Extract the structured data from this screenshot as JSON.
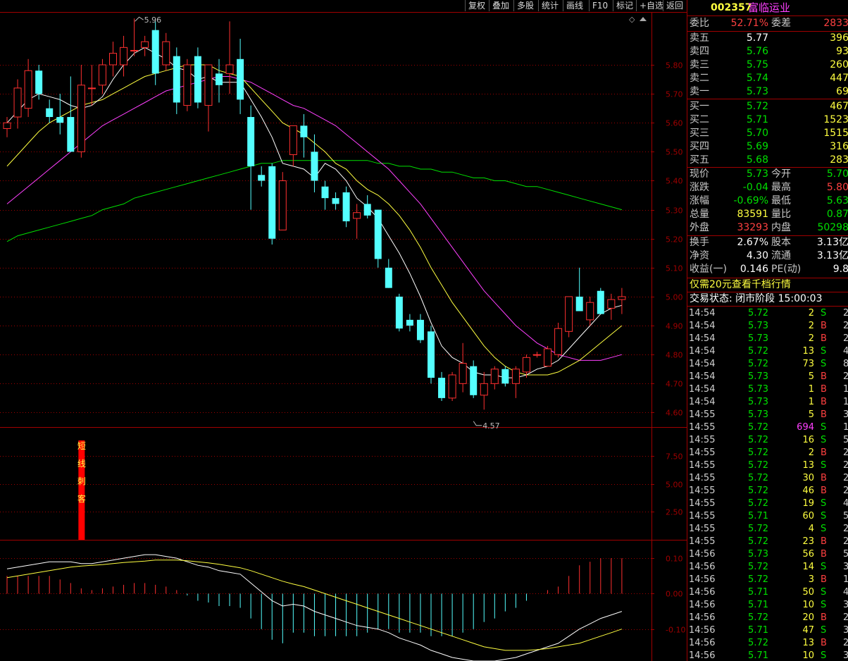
{
  "toolbar": [
    "复权",
    "叠加",
    "多股",
    "统计",
    "画线",
    "F10",
    "标记",
    "+自选",
    "返回"
  ],
  "stock": {
    "code": "002357",
    "name": "富临运业"
  },
  "colors": {
    "up": "#ff3030",
    "down": "#54ffff",
    "ma5": "#ffffff",
    "ma10": "#ffff40",
    "ma20": "#ff40ff",
    "ma60": "#00e000",
    "grid": "#a00000"
  },
  "weibi": {
    "label1": "委比",
    "value1": "52.71%",
    "label2": "委差",
    "value2": "2833"
  },
  "asks": [
    {
      "label": "卖五",
      "price": "5.77",
      "vol": "396"
    },
    {
      "label": "卖四",
      "price": "5.76",
      "vol": "93"
    },
    {
      "label": "卖三",
      "price": "5.75",
      "vol": "260"
    },
    {
      "label": "卖二",
      "price": "5.74",
      "vol": "447"
    },
    {
      "label": "卖一",
      "price": "5.73",
      "vol": "69"
    }
  ],
  "bids": [
    {
      "label": "买一",
      "price": "5.72",
      "vol": "467"
    },
    {
      "label": "买二",
      "price": "5.71",
      "vol": "1523"
    },
    {
      "label": "买三",
      "price": "5.70",
      "vol": "1515"
    },
    {
      "label": "买四",
      "price": "5.69",
      "vol": "316"
    },
    {
      "label": "买五",
      "price": "5.68",
      "vol": "283"
    }
  ],
  "quote": [
    {
      "l1": "现价",
      "v1": "5.73",
      "c1": "green",
      "l2": "今开",
      "v2": "5.70",
      "c2": "green"
    },
    {
      "l1": "涨跌",
      "v1": "-0.04",
      "c1": "green",
      "l2": "最高",
      "v2": "5.80",
      "c2": "red"
    },
    {
      "l1": "涨幅",
      "v1": "-0.69%",
      "c1": "green",
      "l2": "最低",
      "v2": "5.63",
      "c2": "green"
    },
    {
      "l1": "总量",
      "v1": "83591",
      "c1": "yellow",
      "l2": "量比",
      "v2": "0.87",
      "c2": "green"
    },
    {
      "l1": "外盘",
      "v1": "33293",
      "c1": "red",
      "l2": "内盘",
      "v2": "50298",
      "c2": "green"
    }
  ],
  "fundamentals": [
    {
      "l1": "换手",
      "v1": "2.67%",
      "l2": "股本",
      "v2": "3.13亿"
    },
    {
      "l1": "净资",
      "v1": "4.30",
      "l2": "流通",
      "v2": "3.13亿"
    },
    {
      "l1": "收益(一)",
      "v1": "0.146",
      "l2": "PE(动)",
      "v2": "9.8"
    }
  ],
  "promo": "仅需20元查看千档行情",
  "status": "交易状态: 闭市阶段 15:00:03",
  "ticks": [
    {
      "t": "14:54",
      "p": "5.72",
      "v": "2",
      "bs": "S",
      "n": "2"
    },
    {
      "t": "14:54",
      "p": "5.73",
      "v": "2",
      "bs": "B",
      "n": "2"
    },
    {
      "t": "14:54",
      "p": "5.73",
      "v": "2",
      "bs": "B",
      "n": "2"
    },
    {
      "t": "14:54",
      "p": "5.72",
      "v": "13",
      "bs": "S",
      "n": "4"
    },
    {
      "t": "14:54",
      "p": "5.72",
      "v": "73",
      "bs": "S",
      "n": "8"
    },
    {
      "t": "14:54",
      "p": "5.73",
      "v": "5",
      "bs": "B",
      "n": "2"
    },
    {
      "t": "14:54",
      "p": "5.73",
      "v": "1",
      "bs": "B",
      "n": "1"
    },
    {
      "t": "14:54",
      "p": "5.73",
      "v": "1",
      "bs": "B",
      "n": "1"
    },
    {
      "t": "14:55",
      "p": "5.73",
      "v": "5",
      "bs": "B",
      "n": "3"
    },
    {
      "t": "14:55",
      "p": "5.72",
      "v": "694",
      "bs": "S",
      "n": "14"
    },
    {
      "t": "14:55",
      "p": "5.72",
      "v": "16",
      "bs": "S",
      "n": "5"
    },
    {
      "t": "14:55",
      "p": "5.72",
      "v": "2",
      "bs": "B",
      "n": "2"
    },
    {
      "t": "14:55",
      "p": "5.72",
      "v": "13",
      "bs": "S",
      "n": "2"
    },
    {
      "t": "14:55",
      "p": "5.72",
      "v": "30",
      "bs": "B",
      "n": "2"
    },
    {
      "t": "14:55",
      "p": "5.72",
      "v": "46",
      "bs": "B",
      "n": "2"
    },
    {
      "t": "14:55",
      "p": "5.72",
      "v": "19",
      "bs": "S",
      "n": "4"
    },
    {
      "t": "14:55",
      "p": "5.71",
      "v": "60",
      "bs": "S",
      "n": "5"
    },
    {
      "t": "14:55",
      "p": "5.72",
      "v": "4",
      "bs": "S",
      "n": "2"
    },
    {
      "t": "14:55",
      "p": "5.72",
      "v": "23",
      "bs": "B",
      "n": "2"
    },
    {
      "t": "14:56",
      "p": "5.73",
      "v": "56",
      "bs": "B",
      "n": "5"
    },
    {
      "t": "14:56",
      "p": "5.72",
      "v": "14",
      "bs": "S",
      "n": "3"
    },
    {
      "t": "14:56",
      "p": "5.72",
      "v": "3",
      "bs": "B",
      "n": "1"
    },
    {
      "t": "14:56",
      "p": "5.71",
      "v": "50",
      "bs": "S",
      "n": "4"
    },
    {
      "t": "14:56",
      "p": "5.71",
      "v": "10",
      "bs": "S",
      "n": "3"
    },
    {
      "t": "14:56",
      "p": "5.72",
      "v": "20",
      "bs": "B",
      "n": "2"
    },
    {
      "t": "14:56",
      "p": "5.71",
      "v": "47",
      "bs": "S",
      "n": "3"
    },
    {
      "t": "14:56",
      "p": "5.72",
      "v": "13",
      "bs": "B",
      "n": "2"
    },
    {
      "t": "14:56",
      "p": "5.71",
      "v": "10",
      "bs": "S",
      "n": "3"
    }
  ],
  "chart_data": {
    "type": "candlestick",
    "price_axis": {
      "ticks": [
        "5.80",
        "5.70",
        "5.60",
        "5.50",
        "5.40",
        "5.30",
        "5.20",
        "5.10",
        "5.00",
        "4.90",
        "4.80",
        "4.70",
        "4.60"
      ],
      "ylim": [
        4.55,
        5.98
      ]
    },
    "annotations": {
      "high": "5.96",
      "low": "4.57"
    },
    "candles": [
      [
        5.58,
        5.62,
        5.55,
        5.6
      ],
      [
        5.62,
        5.75,
        5.58,
        5.72
      ],
      [
        5.65,
        5.82,
        5.62,
        5.78
      ],
      [
        5.78,
        5.8,
        5.68,
        5.7
      ],
      [
        5.65,
        5.68,
        5.6,
        5.62
      ],
      [
        5.62,
        5.7,
        5.56,
        5.6
      ],
      [
        5.62,
        5.76,
        5.5,
        5.5
      ],
      [
        5.5,
        5.8,
        5.48,
        5.73
      ],
      [
        5.72,
        5.8,
        5.66,
        5.72
      ],
      [
        5.73,
        5.82,
        5.7,
        5.8
      ],
      [
        5.8,
        5.88,
        5.76,
        5.84
      ],
      [
        5.8,
        5.9,
        5.76,
        5.86
      ],
      [
        5.85,
        5.96,
        5.83,
        5.85
      ],
      [
        5.86,
        5.9,
        5.83,
        5.88
      ],
      [
        5.92,
        5.95,
        5.73,
        5.77
      ],
      [
        5.8,
        5.91,
        5.78,
        5.88
      ],
      [
        5.83,
        5.86,
        5.63,
        5.67
      ],
      [
        5.66,
        5.82,
        5.64,
        5.8
      ],
      [
        5.83,
        5.86,
        5.65,
        5.67
      ],
      [
        5.66,
        5.73,
        5.57,
        5.8
      ],
      [
        5.77,
        5.82,
        5.67,
        5.73
      ],
      [
        5.77,
        5.95,
        5.7,
        5.8
      ],
      [
        5.82,
        5.89,
        5.63,
        5.68
      ],
      [
        5.62,
        5.66,
        5.3,
        5.45
      ],
      [
        5.42,
        5.45,
        5.38,
        5.4
      ],
      [
        5.45,
        5.46,
        5.18,
        5.2
      ],
      [
        5.23,
        5.43,
        5.23,
        5.4
      ],
      [
        5.49,
        5.59,
        5.45,
        5.59
      ],
      [
        5.59,
        5.63,
        5.48,
        5.55
      ],
      [
        5.5,
        5.56,
        5.36,
        5.4
      ],
      [
        5.38,
        5.4,
        5.3,
        5.34
      ],
      [
        5.34,
        5.36,
        5.3,
        5.32
      ],
      [
        5.36,
        5.38,
        5.24,
        5.26
      ],
      [
        5.27,
        5.32,
        5.2,
        5.29
      ],
      [
        5.32,
        5.35,
        5.27,
        5.28
      ],
      [
        5.3,
        5.3,
        5.1,
        5.13
      ],
      [
        5.1,
        5.13,
        5.03,
        5.03
      ],
      [
        5.0,
        5.01,
        4.88,
        4.89
      ],
      [
        4.92,
        4.94,
        4.88,
        4.9
      ],
      [
        4.92,
        4.94,
        4.84,
        4.85
      ],
      [
        4.88,
        4.9,
        4.7,
        4.72
      ],
      [
        4.72,
        4.74,
        4.64,
        4.65
      ],
      [
        4.65,
        4.74,
        4.64,
        4.73
      ],
      [
        4.7,
        4.84,
        4.67,
        4.77
      ],
      [
        4.76,
        4.78,
        4.65,
        4.66
      ],
      [
        4.66,
        4.74,
        4.61,
        4.7
      ],
      [
        4.7,
        4.76,
        4.68,
        4.75
      ],
      [
        4.75,
        4.76,
        4.69,
        4.7
      ],
      [
        4.7,
        4.76,
        4.65,
        4.75
      ],
      [
        4.74,
        4.8,
        4.72,
        4.79
      ],
      [
        4.8,
        4.81,
        4.79,
        4.8
      ],
      [
        4.76,
        4.83,
        4.76,
        4.82
      ],
      [
        4.8,
        4.91,
        4.79,
        4.89
      ],
      [
        4.88,
        5.0,
        4.86,
        5.0
      ],
      [
        5.0,
        5.1,
        4.96,
        4.95
      ],
      [
        4.92,
        5.0,
        4.9,
        4.98
      ],
      [
        5.02,
        5.03,
        4.94,
        4.94
      ],
      [
        4.96,
        5.01,
        4.92,
        4.99
      ],
      [
        4.99,
        5.03,
        4.94,
        5.0
      ]
    ],
    "ma5": [
      5.6,
      5.64,
      5.68,
      5.7,
      5.69,
      5.68,
      5.66,
      5.65,
      5.66,
      5.69,
      5.75,
      5.8,
      5.84,
      5.86,
      5.84,
      5.82,
      5.79,
      5.78,
      5.75,
      5.76,
      5.74,
      5.74,
      5.74,
      5.68,
      5.62,
      5.55,
      5.46,
      5.45,
      5.44,
      5.41,
      5.46,
      5.44,
      5.4,
      5.34,
      5.31,
      5.27,
      5.21,
      5.15,
      5.08,
      5.0,
      4.91,
      4.83,
      4.79,
      4.77,
      4.74,
      4.73,
      4.73,
      4.72,
      4.72,
      4.73,
      4.75,
      4.76,
      4.78,
      4.82,
      4.86,
      4.9,
      4.94,
      4.96,
      4.97
    ],
    "ma10": [
      5.45,
      5.49,
      5.53,
      5.57,
      5.6,
      5.62,
      5.64,
      5.66,
      5.67,
      5.68,
      5.7,
      5.72,
      5.74,
      5.76,
      5.77,
      5.78,
      5.79,
      5.8,
      5.8,
      5.8,
      5.78,
      5.77,
      5.76,
      5.72,
      5.68,
      5.64,
      5.6,
      5.58,
      5.56,
      5.53,
      5.5,
      5.46,
      5.44,
      5.4,
      5.37,
      5.35,
      5.32,
      5.28,
      5.23,
      5.17,
      5.1,
      5.04,
      4.98,
      4.93,
      4.88,
      4.83,
      4.79,
      4.76,
      4.74,
      4.73,
      4.73,
      4.73,
      4.74,
      4.76,
      4.78,
      4.81,
      4.84,
      4.87,
      4.9
    ],
    "ma20": [
      5.32,
      5.35,
      5.38,
      5.41,
      5.44,
      5.47,
      5.5,
      5.53,
      5.56,
      5.59,
      5.61,
      5.63,
      5.65,
      5.67,
      5.69,
      5.71,
      5.72,
      5.73,
      5.74,
      5.75,
      5.76,
      5.76,
      5.75,
      5.74,
      5.72,
      5.7,
      5.68,
      5.66,
      5.65,
      5.63,
      5.61,
      5.59,
      5.56,
      5.53,
      5.5,
      5.47,
      5.44,
      5.4,
      5.36,
      5.32,
      5.27,
      5.22,
      5.17,
      5.12,
      5.07,
      5.02,
      4.98,
      4.94,
      4.9,
      4.87,
      4.84,
      4.82,
      4.8,
      4.79,
      4.78,
      4.78,
      4.78,
      4.79,
      4.8
    ],
    "ma60": [
      5.19,
      5.21,
      5.22,
      5.23,
      5.24,
      5.25,
      5.26,
      5.27,
      5.28,
      5.3,
      5.31,
      5.32,
      5.34,
      5.35,
      5.36,
      5.37,
      5.38,
      5.39,
      5.4,
      5.41,
      5.42,
      5.43,
      5.44,
      5.45,
      5.46,
      5.46,
      5.47,
      5.47,
      5.47,
      5.47,
      5.47,
      5.47,
      5.47,
      5.47,
      5.47,
      5.46,
      5.46,
      5.45,
      5.45,
      5.44,
      5.44,
      5.43,
      5.43,
      5.42,
      5.41,
      5.41,
      5.4,
      5.4,
      5.39,
      5.38,
      5.38,
      5.37,
      5.36,
      5.35,
      5.34,
      5.33,
      5.32,
      5.31,
      5.3
    ],
    "indicator": {
      "ticks": [
        "7.50",
        "5.00",
        "2.50"
      ],
      "label": "短线刺客",
      "signal_index": 7,
      "ylim": [
        0,
        10
      ]
    },
    "macd": {
      "ticks": [
        "0.10",
        "0.00",
        "-0.10"
      ],
      "ylim": [
        -0.19,
        0.15
      ],
      "dif": [
        0.07,
        0.075,
        0.08,
        0.085,
        0.09,
        0.09,
        0.09,
        0.085,
        0.085,
        0.09,
        0.095,
        0.1,
        0.105,
        0.11,
        0.11,
        0.105,
        0.1,
        0.09,
        0.08,
        0.075,
        0.065,
        0.06,
        0.055,
        0.03,
        0.005,
        -0.02,
        -0.035,
        -0.03,
        -0.035,
        -0.05,
        -0.06,
        -0.07,
        -0.08,
        -0.09,
        -0.095,
        -0.1,
        -0.11,
        -0.125,
        -0.135,
        -0.145,
        -0.16,
        -0.17,
        -0.18,
        -0.185,
        -0.19,
        -0.19,
        -0.19,
        -0.185,
        -0.18,
        -0.17,
        -0.16,
        -0.15,
        -0.14,
        -0.12,
        -0.1,
        -0.085,
        -0.07,
        -0.06,
        -0.05
      ],
      "dea": [
        0.045,
        0.05,
        0.055,
        0.06,
        0.065,
        0.07,
        0.075,
        0.078,
        0.08,
        0.082,
        0.085,
        0.088,
        0.09,
        0.092,
        0.095,
        0.095,
        0.095,
        0.093,
        0.09,
        0.087,
        0.083,
        0.078,
        0.073,
        0.065,
        0.055,
        0.045,
        0.035,
        0.027,
        0.02,
        0.01,
        0.0,
        -0.01,
        -0.02,
        -0.03,
        -0.04,
        -0.05,
        -0.06,
        -0.07,
        -0.08,
        -0.09,
        -0.1,
        -0.11,
        -0.12,
        -0.13,
        -0.14,
        -0.15,
        -0.155,
        -0.16,
        -0.16,
        -0.16,
        -0.158,
        -0.155,
        -0.15,
        -0.145,
        -0.14,
        -0.13,
        -0.12,
        -0.11,
        -0.1
      ],
      "hist": [
        0.05,
        0.05,
        0.05,
        0.05,
        0.05,
        0.04,
        0.03,
        0.015,
        0.01,
        0.015,
        0.02,
        0.025,
        0.03,
        0.03,
        0.025,
        0.02,
        0.01,
        -0.005,
        -0.02,
        -0.025,
        -0.035,
        -0.035,
        -0.04,
        -0.07,
        -0.1,
        -0.13,
        -0.14,
        -0.11,
        -0.11,
        -0.12,
        -0.12,
        -0.12,
        -0.12,
        -0.12,
        -0.11,
        -0.1,
        -0.1,
        -0.11,
        -0.11,
        -0.11,
        -0.12,
        -0.12,
        -0.12,
        -0.11,
        -0.1,
        -0.08,
        -0.07,
        -0.05,
        -0.04,
        -0.02,
        0.0,
        0.01,
        0.02,
        0.05,
        0.08,
        0.09,
        0.1,
        0.1,
        0.1
      ]
    }
  }
}
